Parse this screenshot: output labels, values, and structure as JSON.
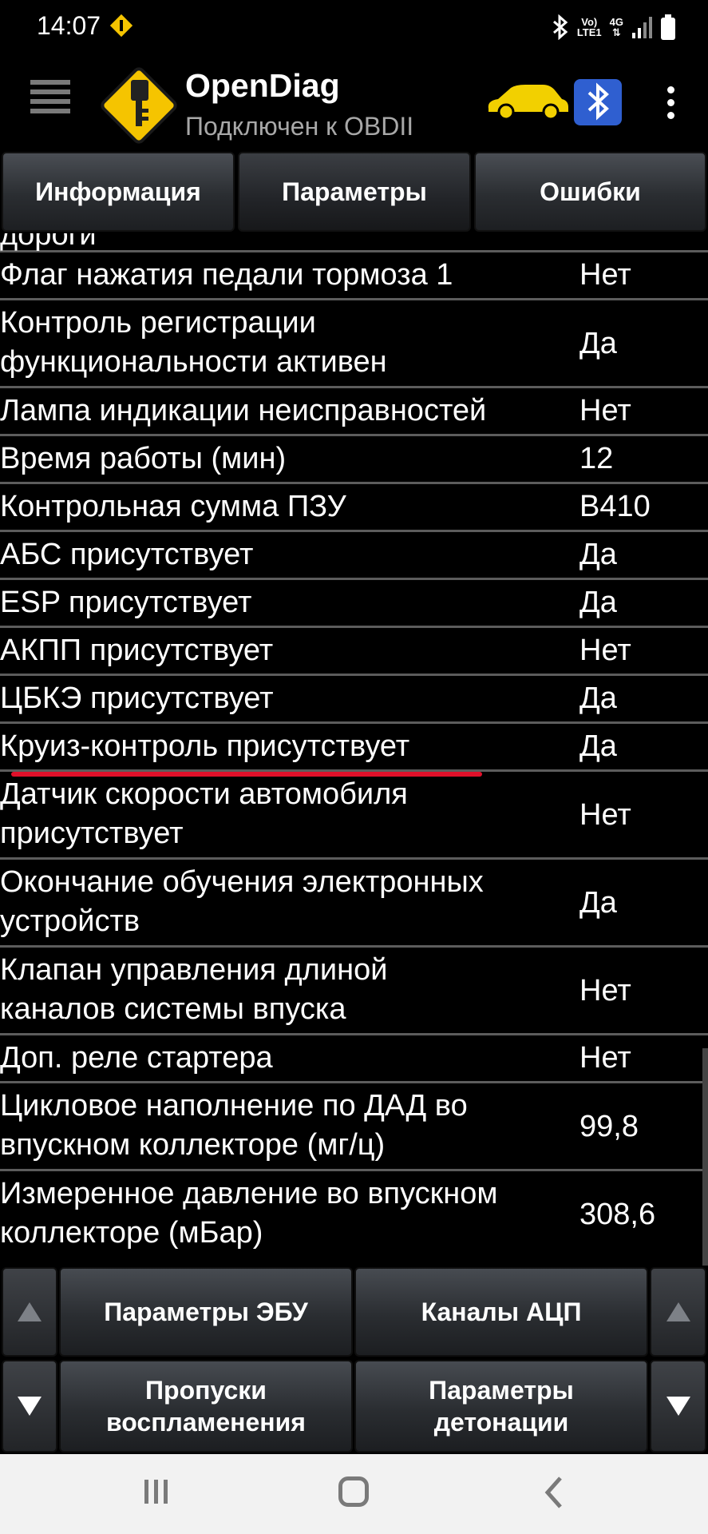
{
  "status_bar": {
    "time": "14:07",
    "network_line1": "Vo)",
    "network_line2": "LTE1",
    "network_type": "4G",
    "icons": [
      "notification-icon",
      "bluetooth-icon",
      "signal-icon",
      "battery-icon"
    ]
  },
  "app_bar": {
    "title": "OpenDiag",
    "subtitle": "Подключен к OBDII",
    "menu_icon": "hamburger-menu-icon",
    "logo_icon": "opendiag-logo-icon",
    "car_icon": "car-icon",
    "bluetooth_icon": "bluetooth-badge-icon",
    "overflow_icon": "more-vert-icon"
  },
  "tabs": [
    {
      "label": "Информация",
      "active": false
    },
    {
      "label": "Параметры",
      "active": true
    },
    {
      "label": "Ошибки",
      "active": false
    }
  ],
  "parameters": [
    {
      "name": "дороги",
      "value": ""
    },
    {
      "name": "Флаг нажатия педали тормоза 1",
      "value": "Нет"
    },
    {
      "name": "Контроль регистрации функциональности активен",
      "value": "Да"
    },
    {
      "name": "Лампа индикации неисправностей",
      "value": "Нет"
    },
    {
      "name": "Время работы (мин)",
      "value": "12"
    },
    {
      "name": "Контрольная сумма ПЗУ",
      "value": "B410"
    },
    {
      "name": "АБС присутствует",
      "value": "Да"
    },
    {
      "name": "ESP присутствует",
      "value": "Да"
    },
    {
      "name": "АКПП присутствует",
      "value": "Нет"
    },
    {
      "name": "ЦБКЭ присутствует",
      "value": "Да"
    },
    {
      "name": "Круиз-контроль присутствует",
      "value": "Да"
    },
    {
      "name": "Датчик скорости автомобиля присутствует",
      "value": "Нет"
    },
    {
      "name": "Окончание обучения электронных устройств",
      "value": "Да"
    },
    {
      "name": "Клапан управления длиной каналов системы впуска",
      "value": "Нет"
    },
    {
      "name": "Доп. реле стартера",
      "value": "Нет"
    },
    {
      "name": "Цикловое наполнение по ДАД во впускном коллекторе (мг/ц)",
      "value": "99,8"
    },
    {
      "name": "Измеренное давление во впускном коллекторе (мБар)",
      "value": "308,6"
    }
  ],
  "bottom_buttons": {
    "ecu_params": "Параметры ЭБУ",
    "adc_channels": "Каналы АЦП",
    "misfires": "Пропуски воспламенения",
    "knock_params": "Параметры детонации",
    "up_icon": "arrow-up-icon",
    "down_icon": "arrow-down-icon"
  },
  "nav_bar": {
    "recents_icon": "recents-icon",
    "home_icon": "home-icon",
    "back_icon": "back-icon"
  },
  "colors": {
    "background": "#000000",
    "highlight_underline": "#e0102a",
    "logo_yellow": "#f5c400",
    "car_yellow": "#f2d000",
    "bluetooth_blue": "#2f5fd0",
    "nav_bar": "#f2f2f2"
  }
}
